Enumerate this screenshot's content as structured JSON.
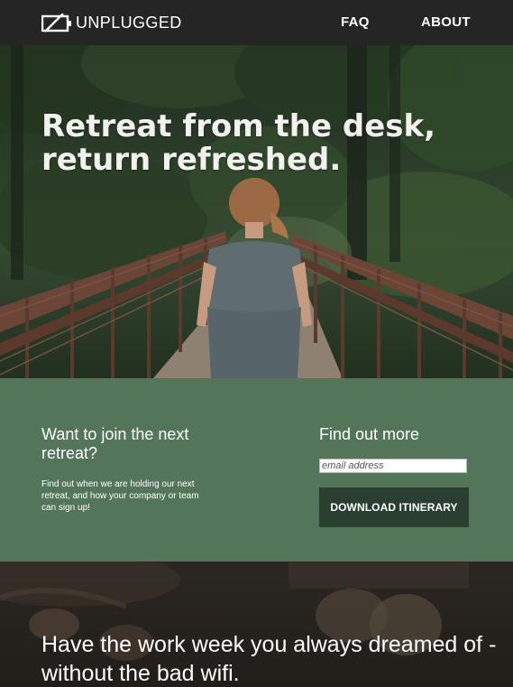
{
  "nav": {
    "brand": "UNPLUGGED",
    "links": [
      "FAQ",
      "ABOUT"
    ]
  },
  "hero": {
    "title_line1": "Retreat from the desk,",
    "title_line2": "return refreshed."
  },
  "signup": {
    "join_title": "Want to join the next retreat?",
    "join_body": "Find out when we are holding our next retreat, and how your company or team can sign up!",
    "more_title": "Find out more",
    "email_placeholder": "email address",
    "download_label": "DOWNLOAD ITINERARY"
  },
  "bottom": {
    "title": "Have the work week you always dreamed of - without the bad wifi."
  },
  "colors": {
    "nav_bg": "#252525",
    "signup_bg": "#53765a",
    "button_bg": "#2a3f30"
  },
  "icons": {
    "logo": "unplugged-battery-icon"
  }
}
